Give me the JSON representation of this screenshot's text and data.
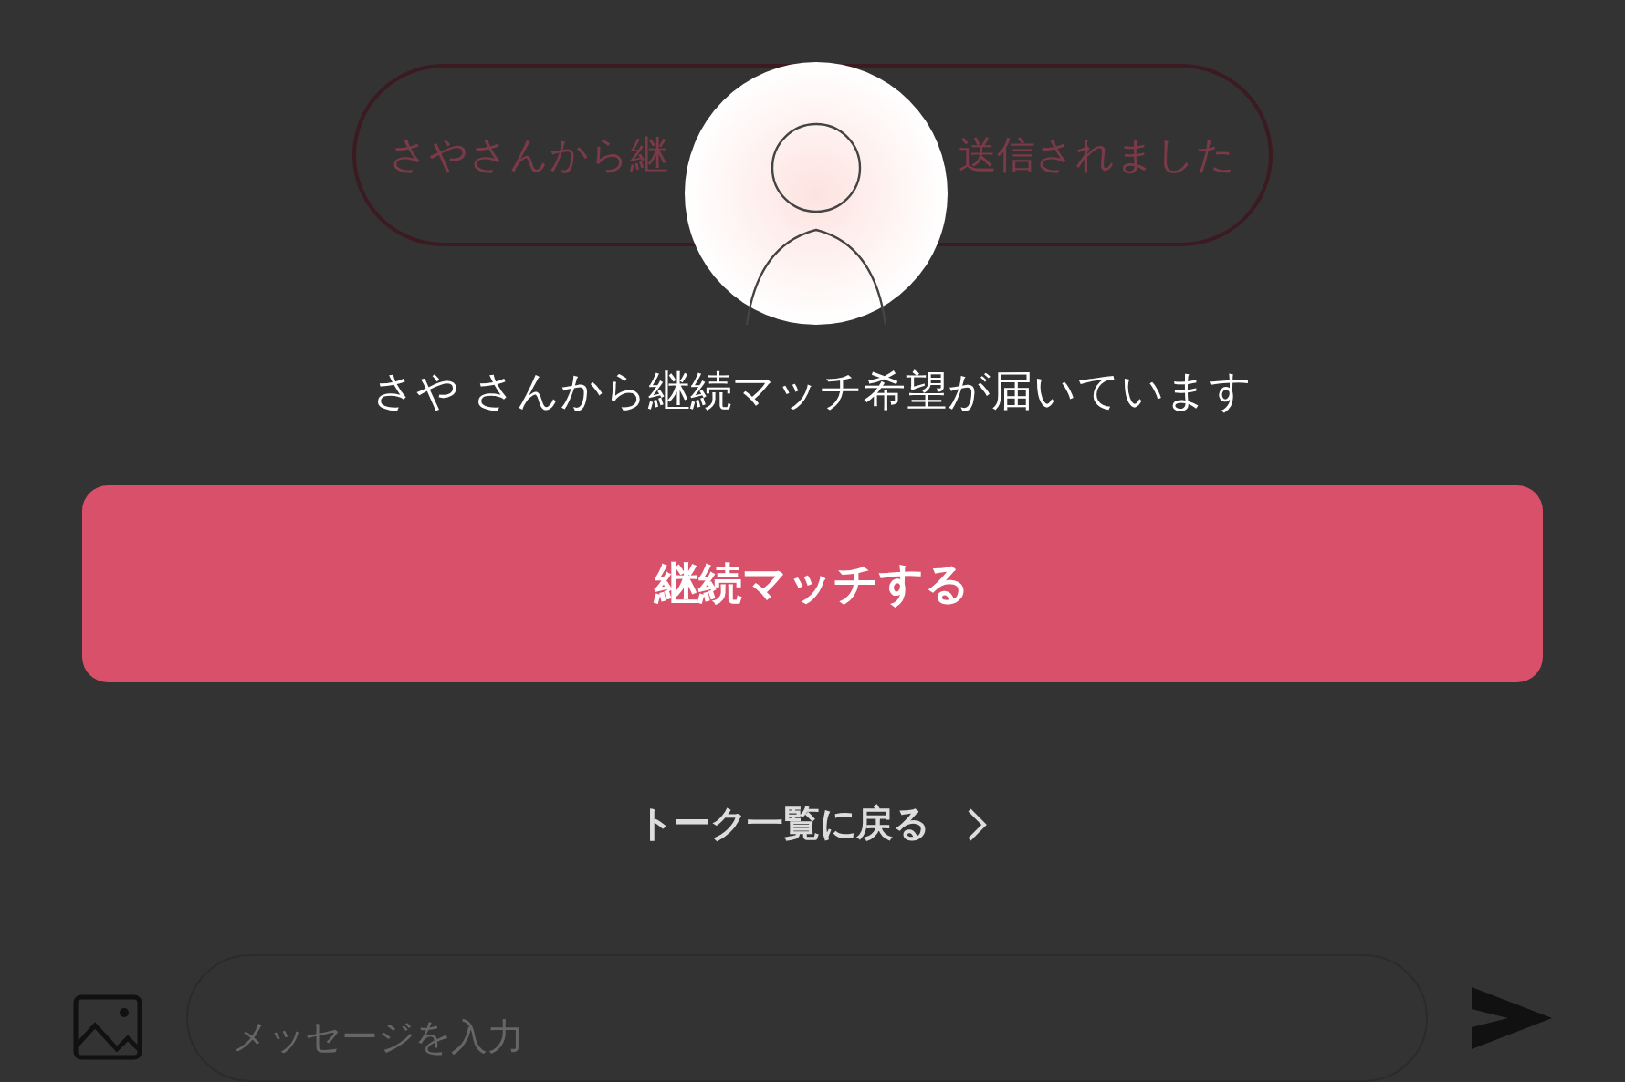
{
  "notice_pill": {
    "text_left": "さやさんから継",
    "text_right": "送信されました"
  },
  "message": "さや さんから継続マッチ希望が届いています",
  "primary_button": {
    "label": "継続マッチする"
  },
  "back_link": {
    "label": "トーク一覧に戻る"
  },
  "composer": {
    "placeholder": "メッセージを入力"
  }
}
